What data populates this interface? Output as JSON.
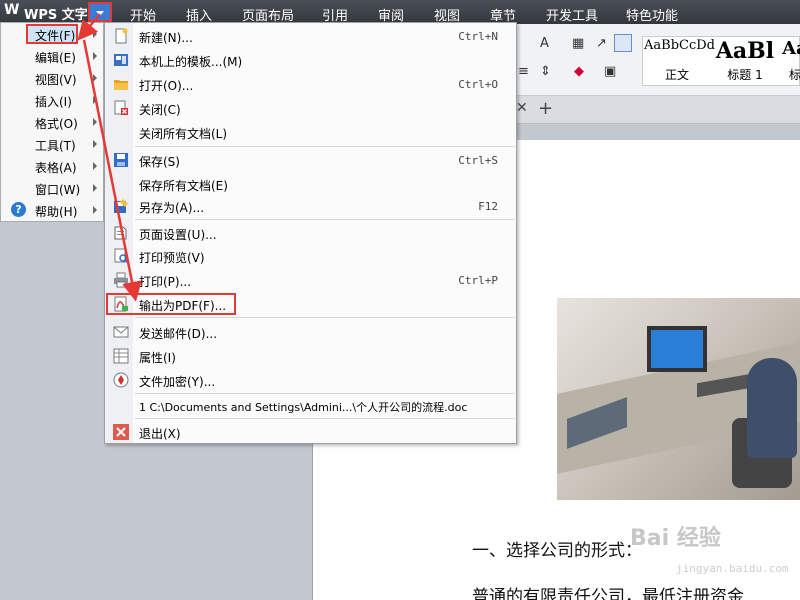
{
  "titlebar": {
    "logo": "W",
    "title": "WPS 文字",
    "tabs": [
      "开始",
      "插入",
      "页面布局",
      "引用",
      "审阅",
      "视图",
      "章节",
      "开发工具",
      "特色功能"
    ]
  },
  "ribbon": {
    "styles": [
      {
        "sample": "AaBbCcDd",
        "name": "正文"
      },
      {
        "sample": "AaBl",
        "name": "标题 1"
      },
      {
        "sample": "Aa",
        "name": "标"
      }
    ]
  },
  "app_menu": {
    "items": [
      {
        "label": "文件(F)",
        "arrow": true
      },
      {
        "label": "编辑(E)",
        "arrow": true
      },
      {
        "label": "视图(V)",
        "arrow": true
      },
      {
        "label": "插入(I)",
        "arrow": true
      },
      {
        "label": "格式(O)",
        "arrow": true
      },
      {
        "label": "工具(T)",
        "arrow": true
      },
      {
        "label": "表格(A)",
        "arrow": true
      },
      {
        "label": "窗口(W)",
        "arrow": true
      },
      {
        "label": "帮助(H)",
        "arrow": true
      }
    ]
  },
  "file_menu": {
    "items": [
      {
        "label": "新建(N)...",
        "shortcut": "Ctrl+N",
        "icon": "new-document-icon"
      },
      {
        "label": "本机上的模板...(M)",
        "shortcut": "",
        "icon": "template-icon"
      },
      {
        "label": "打开(O)...",
        "shortcut": "Ctrl+O",
        "icon": "folder-open-icon"
      },
      {
        "label": "关闭(C)",
        "shortcut": "",
        "icon": "close-document-icon"
      },
      {
        "label": "关闭所有文档(L)",
        "shortcut": "",
        "icon": ""
      },
      {
        "label": "保存(S)",
        "shortcut": "Ctrl+S",
        "icon": "save-icon"
      },
      {
        "label": "保存所有文档(E)",
        "shortcut": "",
        "icon": ""
      },
      {
        "label": "另存为(A)...",
        "shortcut": "F12",
        "icon": "save-as-icon"
      },
      {
        "label": "页面设置(U)...",
        "shortcut": "",
        "icon": "page-setup-icon"
      },
      {
        "label": "打印预览(V)",
        "shortcut": "",
        "icon": "print-preview-icon"
      },
      {
        "label": "打印(P)...",
        "shortcut": "Ctrl+P",
        "icon": "printer-icon"
      },
      {
        "label": "输出为PDF(F)...",
        "shortcut": "",
        "icon": "pdf-export-icon"
      },
      {
        "label": "发送邮件(D)...",
        "shortcut": "",
        "icon": "mail-icon"
      },
      {
        "label": "属性(I)",
        "shortcut": "",
        "icon": "properties-icon"
      },
      {
        "label": "文件加密(Y)...",
        "shortcut": "",
        "icon": "encrypt-icon"
      },
      {
        "label": "1 C:\\Documents and Settings\\Admini...\\个人开公司的流程.doc",
        "shortcut": "",
        "icon": ""
      },
      {
        "label": "退出(X)",
        "shortcut": "",
        "icon": "exit-icon"
      }
    ]
  },
  "document": {
    "heading": "一、选择公司的形式：",
    "paragraph": "普通的有限责任公司，最低注册资金"
  },
  "watermark": {
    "text": "Bai 经验",
    "url": "jingyan.baidu.com"
  },
  "colors": {
    "highlight_red": "#e53935",
    "accent_blue": "#3a7bd5"
  }
}
